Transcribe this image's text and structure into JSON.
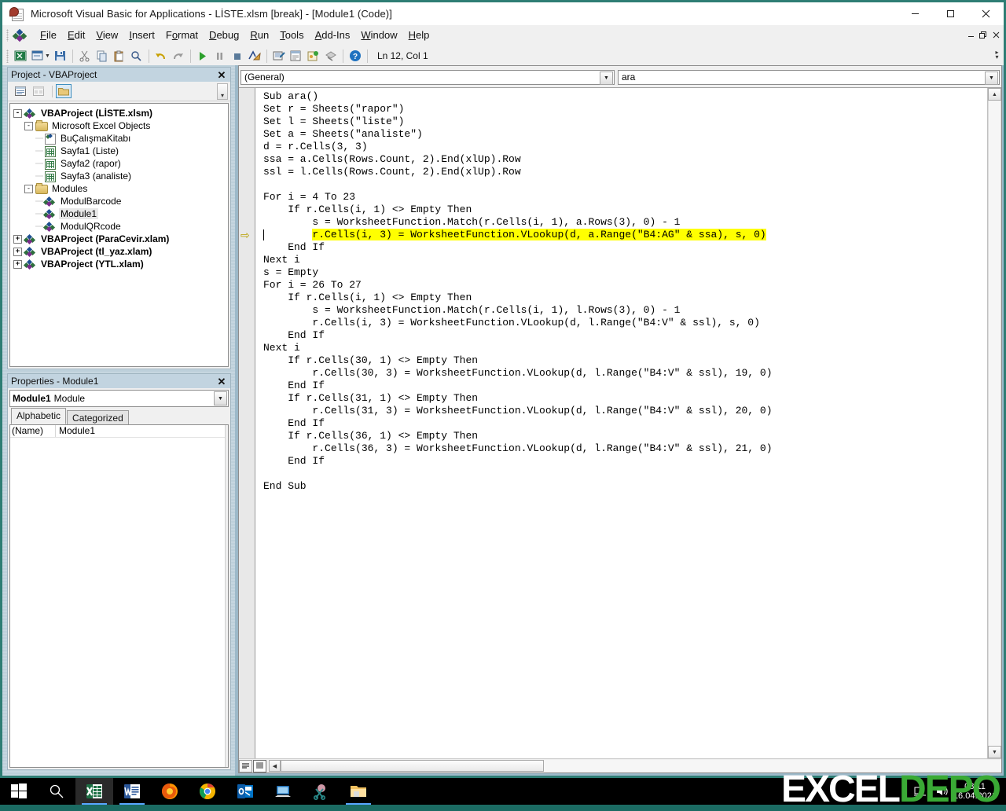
{
  "window": {
    "title": "Microsoft Visual Basic for Applications - LİSTE.xlsm [break] - [Module1 (Code)]",
    "app_icon": "vba-workbook-icon",
    "controls": {
      "minimize": "–",
      "restore": "❐",
      "close": "✕"
    }
  },
  "menubar": {
    "items": [
      {
        "label": "File",
        "accel": "F"
      },
      {
        "label": "Edit",
        "accel": "E"
      },
      {
        "label": "View",
        "accel": "V"
      },
      {
        "label": "Insert",
        "accel": "I"
      },
      {
        "label": "Format",
        "accel": "o"
      },
      {
        "label": "Debug",
        "accel": "D"
      },
      {
        "label": "Run",
        "accel": "R"
      },
      {
        "label": "Tools",
        "accel": "T"
      },
      {
        "label": "Add-Ins",
        "accel": "A"
      },
      {
        "label": "Window",
        "accel": "W"
      },
      {
        "label": "Help",
        "accel": "H"
      }
    ],
    "mdi_controls": {
      "minimize": "–",
      "restore": "❐",
      "close": "✕"
    }
  },
  "toolbar": {
    "buttons": [
      "view-excel-icon",
      "insert-userform-icon",
      "save-icon",
      "cut-icon",
      "copy-icon",
      "paste-icon",
      "find-icon",
      "undo-icon",
      "redo-icon",
      "run-icon",
      "break-icon",
      "reset-icon",
      "design-mode-icon",
      "project-explorer-icon",
      "properties-window-icon",
      "object-browser-icon",
      "toolbox-icon",
      "help-icon"
    ],
    "position_indicator": "Ln 12, Col 1"
  },
  "project_explorer": {
    "title": "Project - VBAProject",
    "close_label": "✕",
    "toolbar": {
      "view_code": "view-code-icon",
      "view_object": "view-object-icon",
      "toggle_folders": "toggle-folders-icon"
    },
    "tree": [
      {
        "level": 0,
        "expander": "-",
        "icon": "vba-project-icon",
        "label": "VBAProject (LİSTE.xlsm)",
        "bold": true,
        "selected": false
      },
      {
        "level": 1,
        "expander": "-",
        "icon": "folder-icon",
        "label": "Microsoft Excel Objects",
        "bold": false,
        "selected": false
      },
      {
        "level": 2,
        "expander": "",
        "icon": "workbook-icon",
        "label": "BuÇalışmaKitabı",
        "bold": false,
        "selected": false
      },
      {
        "level": 2,
        "expander": "",
        "icon": "worksheet-icon",
        "label": "Sayfa1 (Liste)",
        "bold": false,
        "selected": false
      },
      {
        "level": 2,
        "expander": "",
        "icon": "worksheet-icon",
        "label": "Sayfa2 (rapor)",
        "bold": false,
        "selected": false
      },
      {
        "level": 2,
        "expander": "",
        "icon": "worksheet-icon",
        "label": "Sayfa3 (analiste)",
        "bold": false,
        "selected": false
      },
      {
        "level": 1,
        "expander": "-",
        "icon": "folder-icon",
        "label": "Modules",
        "bold": false,
        "selected": false
      },
      {
        "level": 2,
        "expander": "",
        "icon": "module-icon",
        "label": "ModulBarcode",
        "bold": false,
        "selected": false
      },
      {
        "level": 2,
        "expander": "",
        "icon": "module-icon",
        "label": "Module1",
        "bold": false,
        "selected": true
      },
      {
        "level": 2,
        "expander": "",
        "icon": "module-icon",
        "label": "ModulQRcode",
        "bold": false,
        "selected": false
      },
      {
        "level": 0,
        "expander": "+",
        "icon": "vba-project-icon",
        "label": "VBAProject (ParaCevir.xlam)",
        "bold": true,
        "selected": false
      },
      {
        "level": 0,
        "expander": "+",
        "icon": "vba-project-icon",
        "label": "VBAProject (tl_yaz.xlam)",
        "bold": true,
        "selected": false
      },
      {
        "level": 0,
        "expander": "+",
        "icon": "vba-project-icon",
        "label": "VBAProject (YTL.xlam)",
        "bold": true,
        "selected": false
      }
    ]
  },
  "properties": {
    "title": "Properties - Module1",
    "close_label": "✕",
    "object_selector": {
      "name": "Module1",
      "type": "Module"
    },
    "tabs": [
      {
        "label": "Alphabetic",
        "active": true
      },
      {
        "label": "Categorized",
        "active": false
      }
    ],
    "rows": [
      {
        "name": "(Name)",
        "value": "Module1"
      }
    ]
  },
  "code_window": {
    "procedure_combo": "(General)",
    "object_combo": "ara",
    "dropdown_arrow": "▼",
    "exec_marker": "⇨",
    "view_buttons": {
      "procedure_view": "procedure-view-icon",
      "full_module_view": "full-module-view-icon"
    },
    "lines": [
      {
        "n": 1,
        "text": "Sub ara()",
        "indent": 0,
        "highlight": false
      },
      {
        "n": 2,
        "text": "Set r = Sheets(\"rapor\")",
        "indent": 0,
        "highlight": false
      },
      {
        "n": 3,
        "text": "Set l = Sheets(\"liste\")",
        "indent": 0,
        "highlight": false
      },
      {
        "n": 4,
        "text": "Set a = Sheets(\"analiste\")",
        "indent": 0,
        "highlight": false
      },
      {
        "n": 5,
        "text": "d = r.Cells(3, 3)",
        "indent": 0,
        "highlight": false
      },
      {
        "n": 6,
        "text": "ssa = a.Cells(Rows.Count, 2).End(xlUp).Row",
        "indent": 0,
        "highlight": false
      },
      {
        "n": 7,
        "text": "ssl = l.Cells(Rows.Count, 2).End(xlUp).Row",
        "indent": 0,
        "highlight": false
      },
      {
        "n": 8,
        "text": "",
        "indent": 0,
        "highlight": false
      },
      {
        "n": 9,
        "text": "For i = 4 To 23",
        "indent": 0,
        "highlight": false
      },
      {
        "n": 10,
        "text": "If r.Cells(i, 1) <> Empty Then",
        "indent": 1,
        "highlight": false
      },
      {
        "n": 11,
        "text": "s = WorksheetFunction.Match(r.Cells(i, 1), a.Rows(3), 0) - 1",
        "indent": 2,
        "highlight": false
      },
      {
        "n": 12,
        "text": "r.Cells(i, 3) = WorksheetFunction.VLookup(d, a.Range(\"B4:AG\" & ssa), s, 0)",
        "indent": 2,
        "highlight": true
      },
      {
        "n": 13,
        "text": "End If",
        "indent": 1,
        "highlight": false
      },
      {
        "n": 14,
        "text": "Next i",
        "indent": 0,
        "highlight": false
      },
      {
        "n": 15,
        "text": "s = Empty",
        "indent": 0,
        "highlight": false
      },
      {
        "n": 16,
        "text": "For i = 26 To 27",
        "indent": 0,
        "highlight": false
      },
      {
        "n": 17,
        "text": "If r.Cells(i, 1) <> Empty Then",
        "indent": 1,
        "highlight": false
      },
      {
        "n": 18,
        "text": "s = WorksheetFunction.Match(r.Cells(i, 1), l.Rows(3), 0) - 1",
        "indent": 2,
        "highlight": false
      },
      {
        "n": 19,
        "text": "r.Cells(i, 3) = WorksheetFunction.VLookup(d, l.Range(\"B4:V\" & ssl), s, 0)",
        "indent": 2,
        "highlight": false
      },
      {
        "n": 20,
        "text": "End If",
        "indent": 1,
        "highlight": false
      },
      {
        "n": 21,
        "text": "Next i",
        "indent": 0,
        "highlight": false
      },
      {
        "n": 22,
        "text": "If r.Cells(30, 1) <> Empty Then",
        "indent": 1,
        "highlight": false
      },
      {
        "n": 23,
        "text": "r.Cells(30, 3) = WorksheetFunction.VLookup(d, l.Range(\"B4:V\" & ssl), 19, 0)",
        "indent": 2,
        "highlight": false
      },
      {
        "n": 24,
        "text": "End If",
        "indent": 1,
        "highlight": false
      },
      {
        "n": 25,
        "text": "If r.Cells(31, 1) <> Empty Then",
        "indent": 1,
        "highlight": false
      },
      {
        "n": 26,
        "text": "r.Cells(31, 3) = WorksheetFunction.VLookup(d, l.Range(\"B4:V\" & ssl), 20, 0)",
        "indent": 2,
        "highlight": false
      },
      {
        "n": 27,
        "text": "End If",
        "indent": 1,
        "highlight": false
      },
      {
        "n": 28,
        "text": "If r.Cells(36, 1) <> Empty Then",
        "indent": 1,
        "highlight": false
      },
      {
        "n": 29,
        "text": "r.Cells(36, 3) = WorksheetFunction.VLookup(d, l.Range(\"B4:V\" & ssl), 21, 0)",
        "indent": 2,
        "highlight": false
      },
      {
        "n": 30,
        "text": "End If",
        "indent": 1,
        "highlight": false
      },
      {
        "n": 31,
        "text": "",
        "indent": 0,
        "highlight": false
      },
      {
        "n": 32,
        "text": "End Sub",
        "indent": 0,
        "highlight": false
      }
    ]
  },
  "taskbar": {
    "items": [
      {
        "name": "start-button",
        "icon": "windows-logo-icon",
        "running": false,
        "active": false
      },
      {
        "name": "search-button",
        "icon": "search-icon",
        "running": false,
        "active": false
      },
      {
        "name": "excel-task",
        "icon": "excel-icon",
        "running": true,
        "active": true
      },
      {
        "name": "word-task",
        "icon": "word-icon",
        "running": true,
        "active": false
      },
      {
        "name": "firefox-task",
        "icon": "firefox-icon",
        "running": false,
        "active": false
      },
      {
        "name": "chrome-task",
        "icon": "chrome-icon",
        "running": false,
        "active": false
      },
      {
        "name": "outlook-task",
        "icon": "outlook-icon",
        "running": false,
        "active": false
      },
      {
        "name": "remote-desktop-task",
        "icon": "remote-desktop-icon",
        "running": false,
        "active": false
      },
      {
        "name": "snipping-tool-task",
        "icon": "snipping-tool-icon",
        "running": false,
        "active": false
      },
      {
        "name": "file-explorer-task",
        "icon": "folder-icon",
        "running": true,
        "active": false
      }
    ],
    "tray": {
      "network_icon": "network-icon",
      "volume_icon": "volume-icon"
    },
    "clock": {
      "time": "08:11",
      "date": "16.04.2021"
    }
  },
  "watermark": {
    "part1": "EXCEL",
    "part2": "DEPO"
  }
}
